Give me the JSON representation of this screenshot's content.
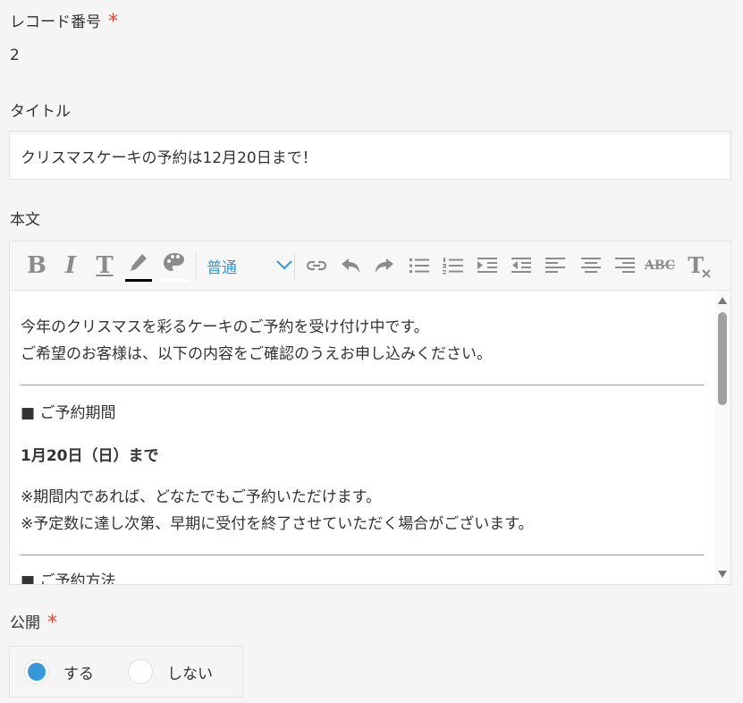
{
  "fields": {
    "record_number": {
      "label": "レコード番号",
      "required_mark": "*",
      "value": "2"
    },
    "title": {
      "label": "タイトル",
      "value": "クリスマスケーキの予約は12月20日まで！"
    },
    "body": {
      "label": "本文"
    },
    "publish": {
      "label": "公開",
      "required_mark": "*",
      "options": [
        {
          "label": "する",
          "selected": true
        },
        {
          "label": "しない",
          "selected": false
        }
      ]
    }
  },
  "toolbar": {
    "bold_glyph": "B",
    "italic_glyph": "I",
    "text_glyph": "T",
    "strike_glyph": "ABC",
    "clear_glyph": "T",
    "font_size_value": "普通",
    "icons": [
      "bold-icon",
      "italic-icon",
      "text-size-icon",
      "font-color-icon",
      "background-color-icon",
      "chevron-down-icon",
      "link-icon",
      "undo-icon",
      "redo-icon",
      "bulleted-list-icon",
      "numbered-list-icon",
      "indent-icon",
      "outdent-icon",
      "align-left-icon",
      "align-center-icon",
      "align-right-icon",
      "strikethrough-icon",
      "clear-format-icon"
    ]
  },
  "editor": {
    "intro_line1": "今年のクリスマスを彩るケーキのご予約を受け付け中です。",
    "intro_line2": "ご希望のお客様は、以下の内容をご確認のうえお申し込みください。",
    "section1_heading": "■ ご予約期間",
    "deadline": "1月20日（日）まで",
    "note1": "※期間内であれば、どなたでもご予約いただけます。",
    "note2": "※予定数に達し次第、早期に受付を終了させていただく場合がございます。",
    "section2_heading_partial": "■ ご予約方法"
  },
  "colors": {
    "accent": "#3498db",
    "required": "#e74c3c",
    "icon": "#8c8c8c"
  }
}
